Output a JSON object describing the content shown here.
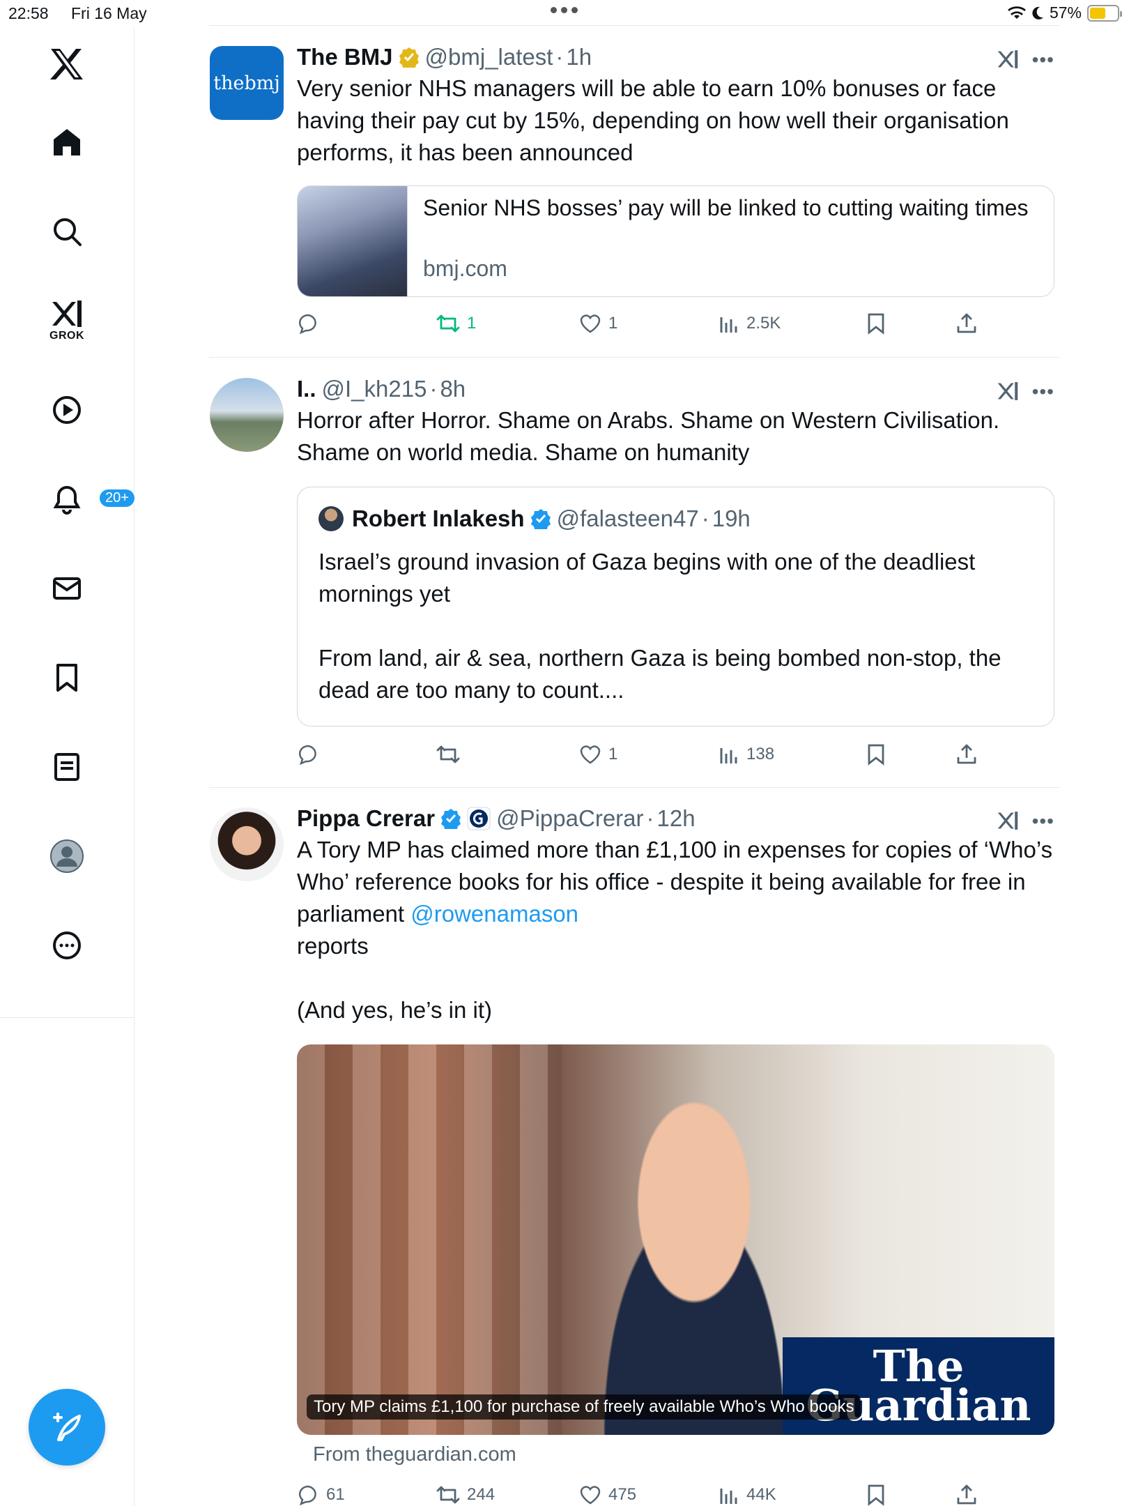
{
  "status_bar": {
    "time": "22:58",
    "date": "Fri 16 May",
    "battery": "57%",
    "battery_level": 0.57
  },
  "sidebar": {
    "items": [
      {
        "icon": "x-logo-icon"
      },
      {
        "icon": "home-icon"
      },
      {
        "icon": "search-icon"
      },
      {
        "icon": "grok-icon",
        "label": "GROK"
      },
      {
        "icon": "video-play-icon"
      },
      {
        "icon": "notifications-bell-icon",
        "badge": "20+"
      },
      {
        "icon": "messages-envelope-icon"
      },
      {
        "icon": "bookmark-icon"
      },
      {
        "icon": "lists-icon"
      },
      {
        "icon": "profile-avatar-icon"
      },
      {
        "icon": "more-circle-icon"
      }
    ],
    "compose_icon": "compose-feather-icon"
  },
  "tweets": [
    {
      "name": "The BMJ",
      "verified": "gold",
      "handle": "@bmj_latest",
      "sep": "·",
      "time": "1h",
      "avatar_text": "thebmj",
      "text": "Very senior NHS managers will be able to earn 10% bonuses or face having their pay cut by 15%, depending on how well their organisation performs, it has been announced",
      "card": {
        "title": "Senior NHS bosses’ pay will be linked to cutting waiting times",
        "domain": "bmj.com"
      },
      "actions": {
        "replies": "",
        "reposts": "1",
        "likes": "1",
        "views": "2.5K"
      }
    },
    {
      "name": "I..",
      "handle": "@I_kh215",
      "sep": "·",
      "time": "8h",
      "text": "Horror after Horror. Shame on Arabs. Shame on Western Civilisation. Shame on world media. Shame on humanity",
      "quote": {
        "name": "Robert Inlakesh",
        "verified": "blue",
        "handle": "@falasteen47",
        "sep": "·",
        "time": "19h",
        "text_1": "Israel’s ground invasion of Gaza begins with one of the deadliest mornings yet",
        "text_2": "From land, air & sea, northern Gaza is being bombed non-stop, the dead are too many to count...."
      },
      "actions": {
        "replies": "",
        "reposts": "",
        "likes": "1",
        "views": "138"
      }
    },
    {
      "name": "Pippa Crerar",
      "verified": "blue",
      "affiliate_icon": "guardian-affiliate-icon",
      "handle": "@PippaCrerar",
      "sep": "·",
      "time": "12h",
      "text_1": "A Tory MP has claimed more than £1,100 in expenses for copies of ‘Who’s Who’ reference books for his office - despite it being available for free in parliament",
      "mention": "@rowenamason",
      "text_2": "reports",
      "text_3": "(And yes, he’s in it)",
      "media": {
        "caption": "Tory MP claims £1,100 for purchase of freely available Who’s Who books",
        "brand_line1": "The",
        "brand_line2": "Guardian"
      },
      "from": "From theguardian.com",
      "actions": {
        "replies": "61",
        "reposts": "244",
        "likes": "475",
        "views": "44K"
      }
    }
  ],
  "colors": {
    "accent": "#1d9bf0",
    "repost_active": "#00ba7c",
    "muted": "#536471",
    "gold_badge": "#e2b719",
    "guardian_blue": "#052962"
  }
}
